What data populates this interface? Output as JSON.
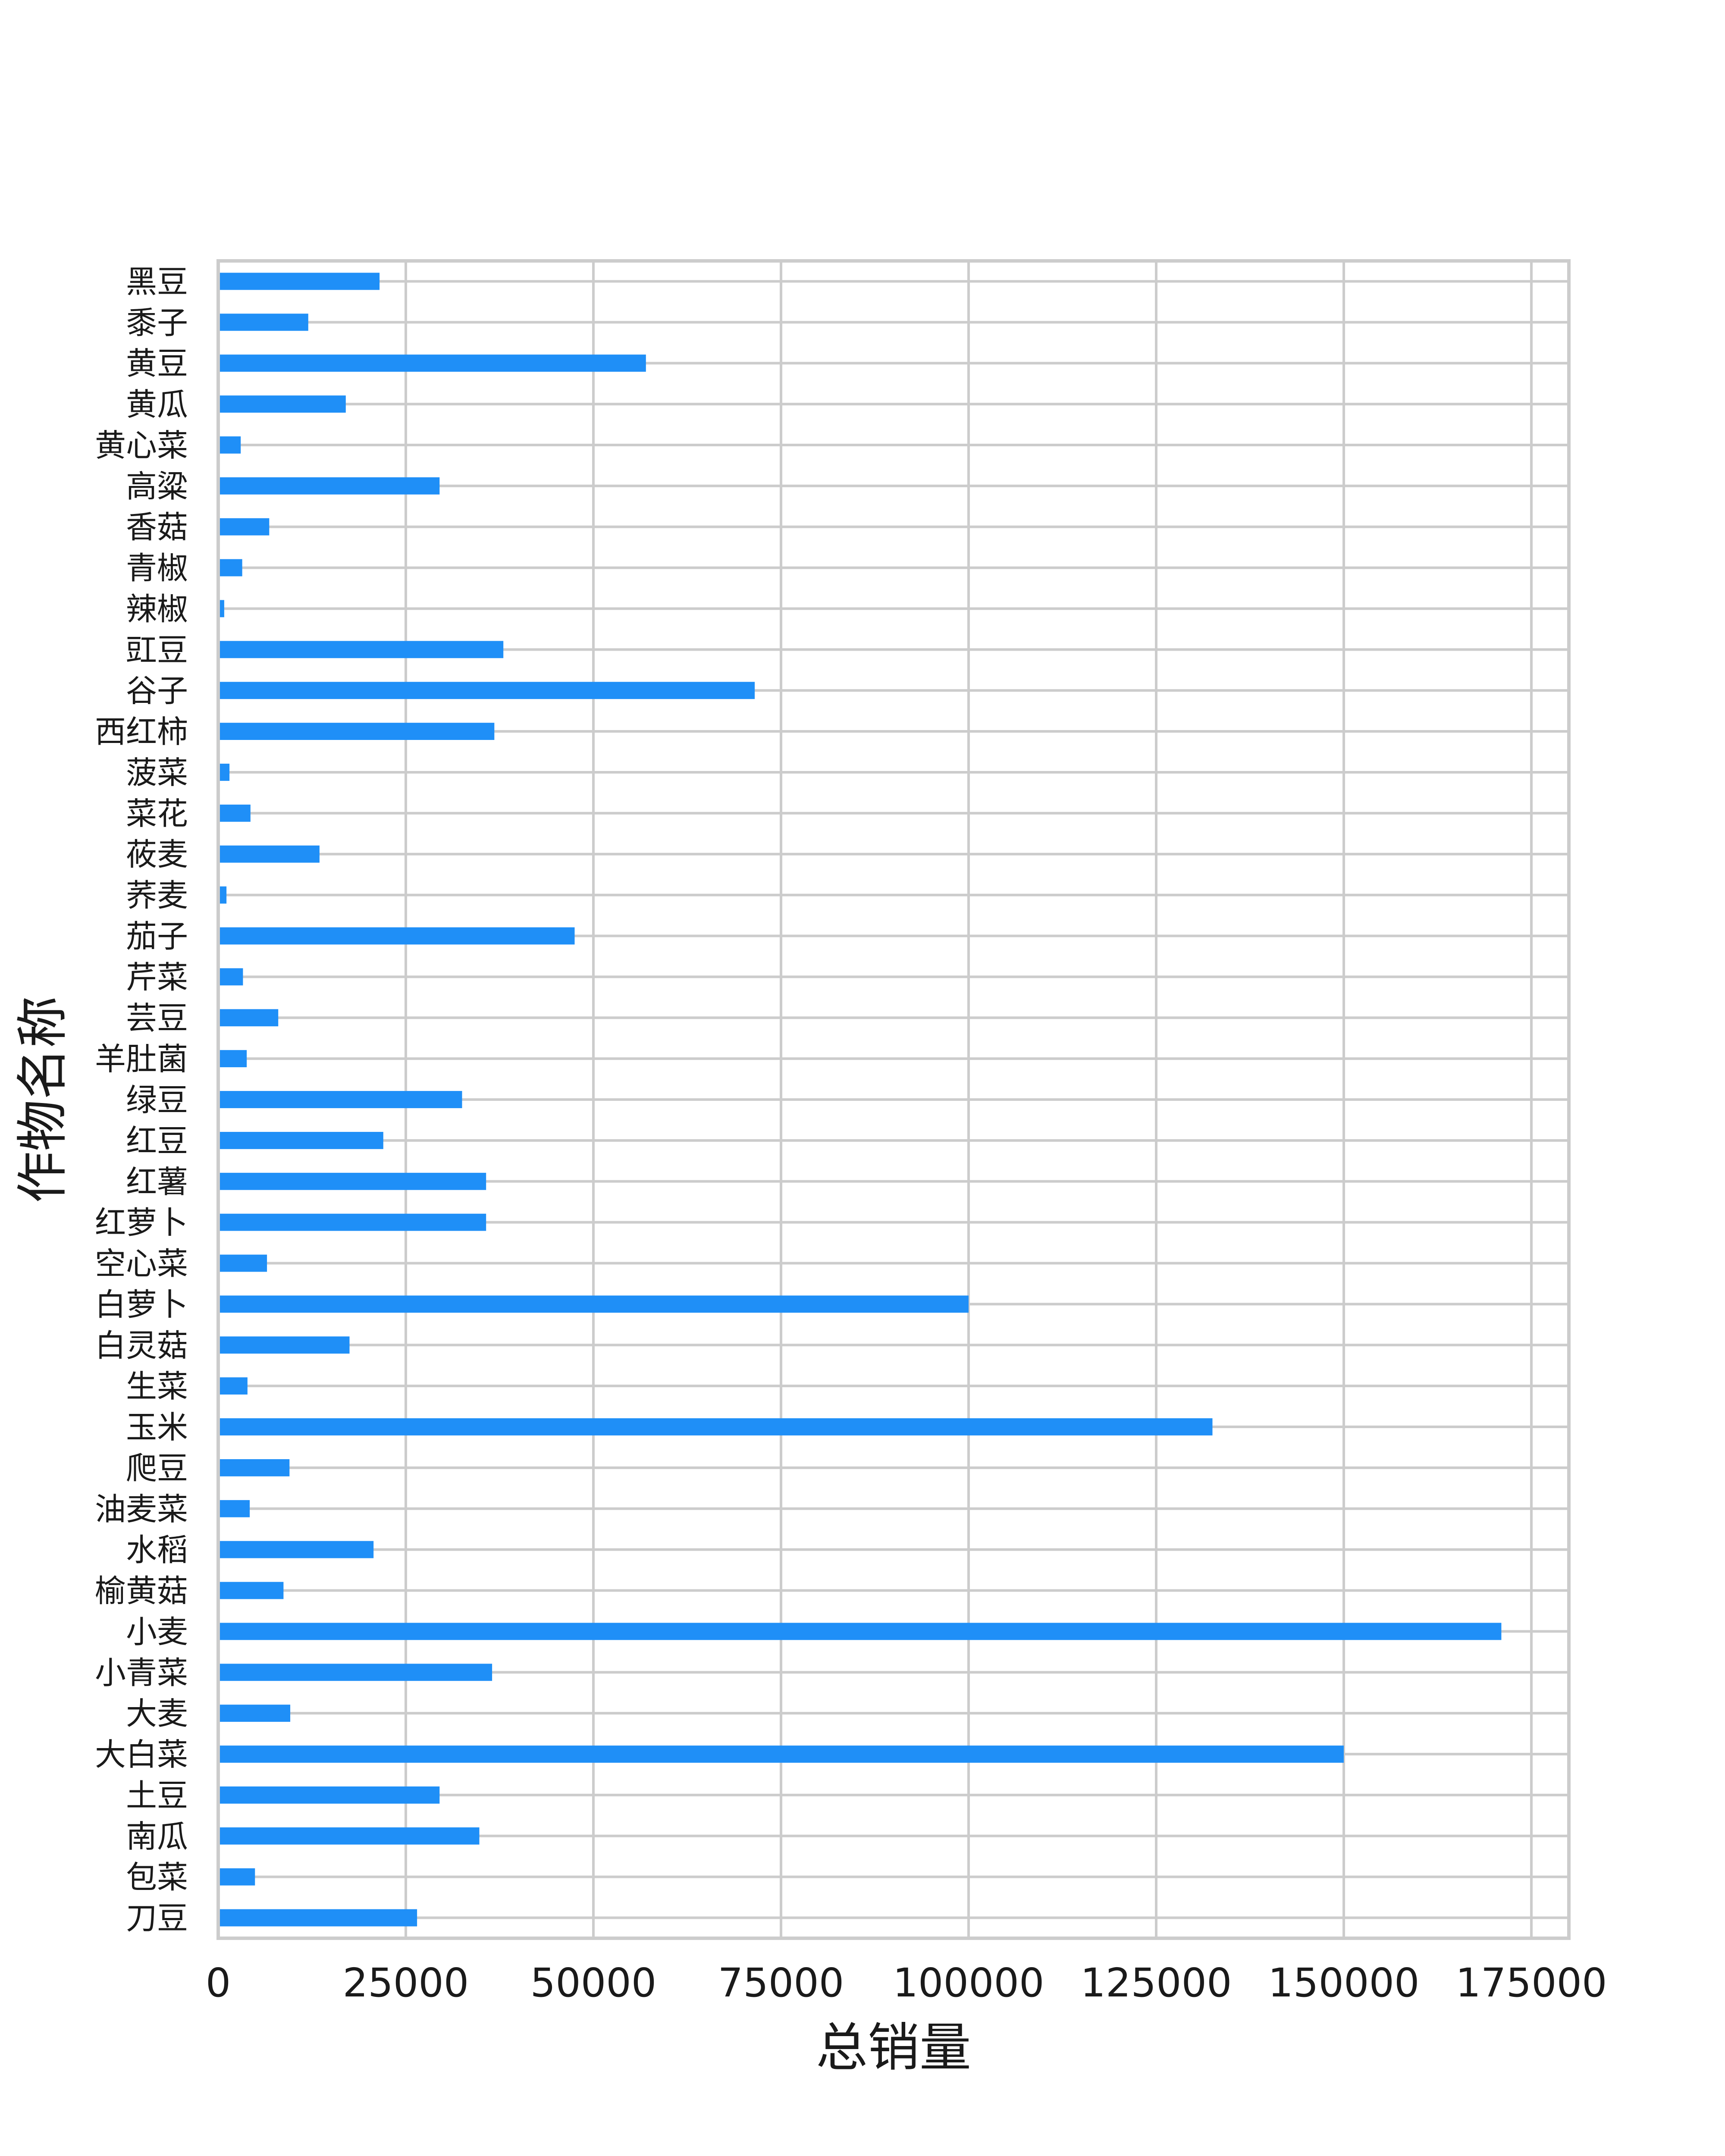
{
  "colors": {
    "bar": "#1f8ff7",
    "grid": "#cccccc",
    "frame": "#cccccc",
    "background": "#ffffff"
  },
  "chart_data": {
    "type": "bar",
    "orientation": "horizontal",
    "xlabel": "总销量",
    "ylabel": "作物名称",
    "xlim": [
      0,
      180000
    ],
    "x_ticks": [
      0,
      25000,
      50000,
      75000,
      100000,
      125000,
      150000,
      175000
    ],
    "x_tick_labels": [
      "0",
      "25000",
      "50000",
      "75000",
      "100000",
      "125000",
      "150000",
      "175000"
    ],
    "grid": true,
    "categories": [
      "黑豆",
      "黍子",
      "黄豆",
      "黄瓜",
      "黄心菜",
      "高粱",
      "香菇",
      "青椒",
      "辣椒",
      "豇豆",
      "谷子",
      "西红柿",
      "菠菜",
      "菜花",
      "莜麦",
      "荞麦",
      "茄子",
      "芹菜",
      "芸豆",
      "羊肚菌",
      "绿豆",
      "红豆",
      "红薯",
      "红萝卜",
      "空心菜",
      "白萝卜",
      "白灵菇",
      "生菜",
      "玉米",
      "爬豆",
      "油麦菜",
      "水稻",
      "榆黄菇",
      "小麦",
      "小青菜",
      "大麦",
      "大白菜",
      "土豆",
      "南瓜",
      "包菜",
      "刀豆"
    ],
    "values": [
      21500,
      12000,
      57000,
      17000,
      3000,
      29500,
      6800,
      3200,
      800,
      38000,
      71500,
      36800,
      1500,
      4300,
      13500,
      1100,
      47500,
      3300,
      8000,
      3800,
      32500,
      22000,
      35700,
      35700,
      6500,
      100000,
      17500,
      3900,
      132500,
      9500,
      4200,
      20700,
      8700,
      171000,
      36500,
      9600,
      150000,
      29500,
      34800,
      4900,
      26500
    ]
  }
}
